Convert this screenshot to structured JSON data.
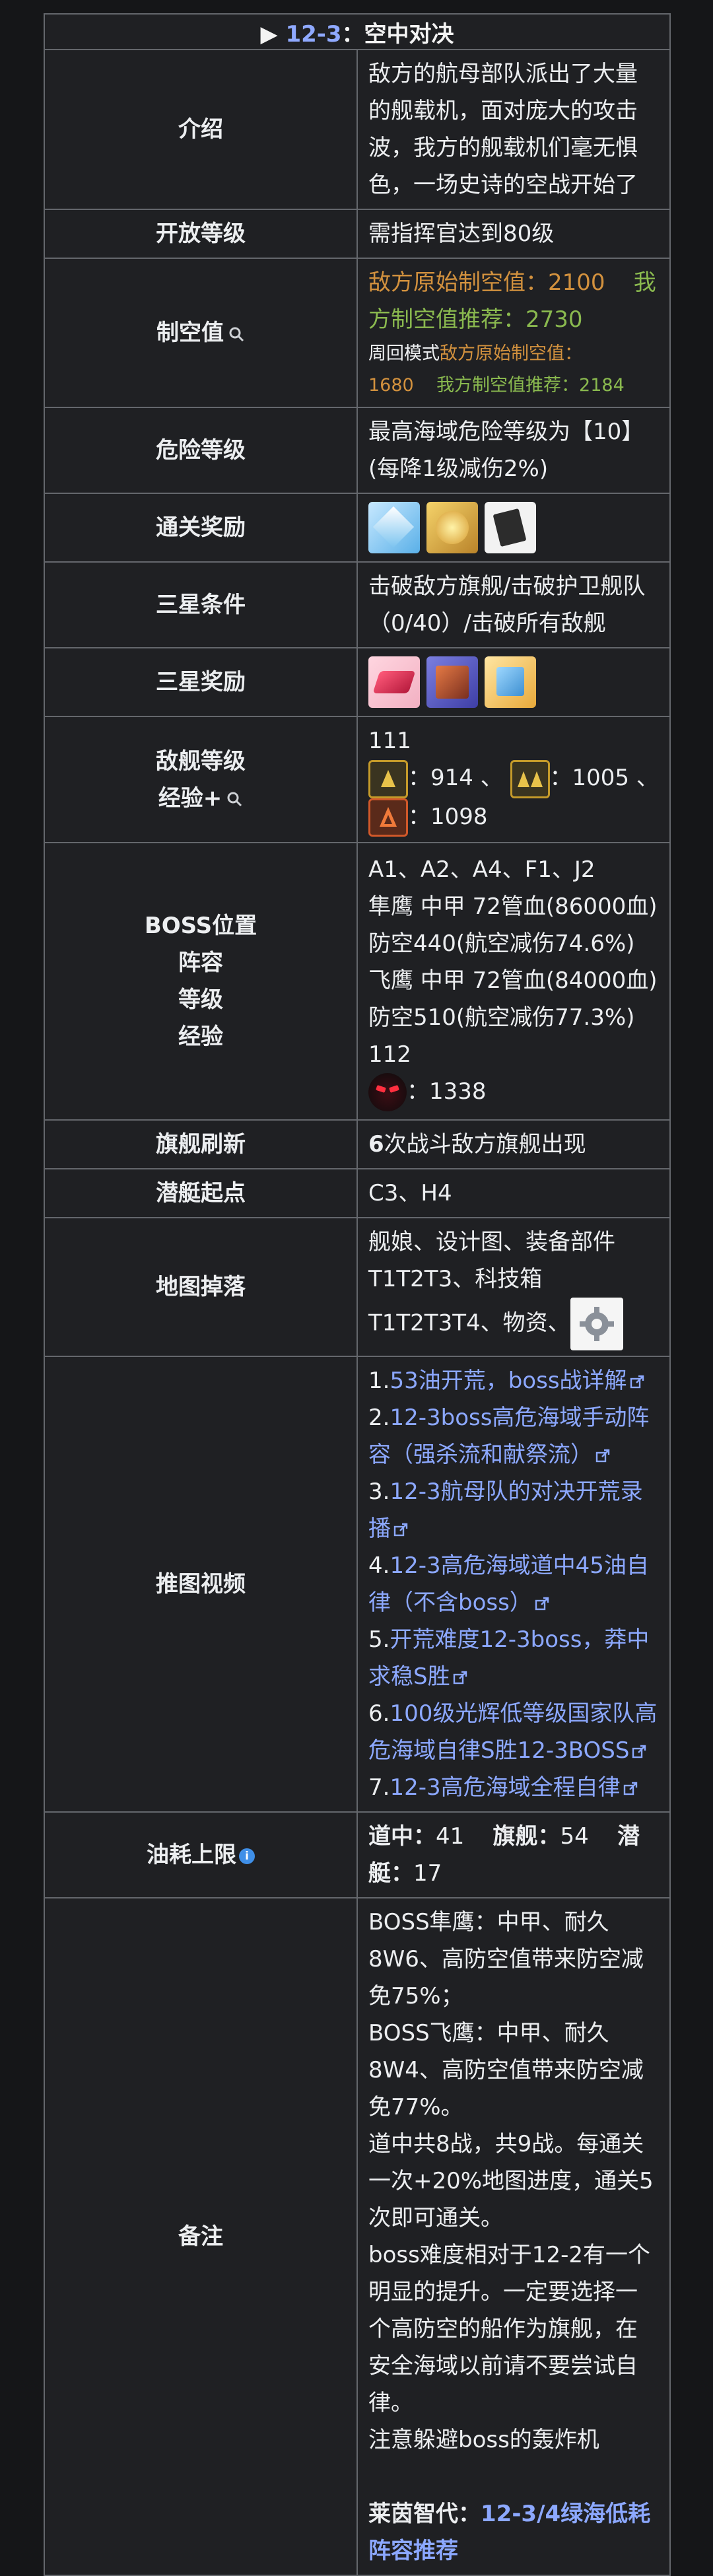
{
  "title": {
    "arrow": "▶",
    "code": "12-3",
    "sep": "：",
    "name": "空中对决"
  },
  "labels": {
    "intro": "介绍",
    "open_level": "开放等级",
    "air_control": "制空值",
    "danger": "危险等级",
    "clear_reward": "通关奖励",
    "three_star_cond": "三星条件",
    "three_star_reward": "三星奖励",
    "enemy_level_line1": "敌舰等级",
    "enemy_level_line2": "经验+",
    "boss_lines": [
      "BOSS位置",
      "阵容",
      "等级",
      "经验"
    ],
    "flagship_refresh": "旗舰刷新",
    "sub_start": "潜艇起点",
    "map_drop": "地图掉落",
    "video": "推图视频",
    "oil_limit": "油耗上限",
    "notes": "备注"
  },
  "intro_text": "敌方的航母部队派出了大量的舰载机，面对庞大的攻击波，我方的舰载机们毫无惧色，一场史诗的空战开始了",
  "open_level_text": "需指挥官达到80级",
  "air_control": {
    "enemy": "敌方原始制空值：2100",
    "ours": "我方制空值推荐：2730",
    "loop_prefix": "周回模式",
    "loop_enemy": "敌方原始制空值：1680",
    "loop_ours": "我方制空值推荐：2184"
  },
  "danger_text": "最高海域危险等级为【10】(每降1级减伤2%)",
  "clear_reward_icons": [
    "cube-icon",
    "coin-icon",
    "book-icon"
  ],
  "three_star_cond_text": "击破敌方旗舰/击破护卫舰队（0/40）/击破所有敌舰",
  "three_star_reward_icons": [
    "gem-icon",
    "box-icon",
    "chip-icon"
  ],
  "enemy_level": {
    "level": "111",
    "exp1": "：914 、",
    "exp2": "：1005 、",
    "exp3": "：1098"
  },
  "boss": {
    "positions": "A1、A2、A4、F1、J2",
    "line1": "隼鹰 中甲 72管血(86000血) 防空440(航空减伤74.6%)",
    "line2": "飞鹰 中甲 72管血(84000血) 防空510(航空减伤77.3%)",
    "level": "112",
    "exp": "：1338"
  },
  "flagship": {
    "count": "6",
    "text": "次战斗敌方旗舰出现"
  },
  "sub_start_text": "C3、H4",
  "map_drop_text": "舰娘、设计图、装备部件T1T2T3、科技箱T1T2T3T4、物资、",
  "videos": [
    {
      "num": "1.",
      "title": "53油开荒，boss战详解"
    },
    {
      "num": "2.",
      "title": "12-3boss高危海域手动阵容（强杀流和献祭流）"
    },
    {
      "num": "3.",
      "title": "12-3航母队的对决开荒录播"
    },
    {
      "num": "4.",
      "title": "12-3高危海域道中45油自律（不含boss）"
    },
    {
      "num": "5.",
      "title": "开荒难度12-3boss，莽中求稳S胜"
    },
    {
      "num": "6.",
      "title": "100级光辉低等级国家队高危海域自律S胜12-3BOSS"
    },
    {
      "num": "7.",
      "title": "12-3高危海域全程自律"
    }
  ],
  "oil": {
    "road_label": "道中：",
    "road": "41",
    "flag_label": "旗舰：",
    "flag": "54",
    "sub_label": "潜艇：",
    "sub": "17"
  },
  "notes": {
    "lines": [
      "BOSS隼鹰：中甲、耐久8W6、高防空值带来防空减免75%；",
      "BOSS飞鹰：中甲、耐久8W4、高防空值带来防空减免77%。",
      "道中共8战，共9战。每通关一次+20%地图进度，通关5次即可通关。",
      "boss难度相对于12-2有一个明显的提升。一定要选择一个高防空的船作为旗舰，在安全海域以前请不要尝试自律。",
      "注意躲避boss的轰炸机"
    ],
    "footer_label": "莱茵智代：",
    "footer_link": "12-3/4绿海低耗阵容推荐"
  },
  "colors": {
    "link": "#8ca8ff",
    "orange": "#d2913e",
    "green": "#8ab94f",
    "border": "#64676c"
  }
}
